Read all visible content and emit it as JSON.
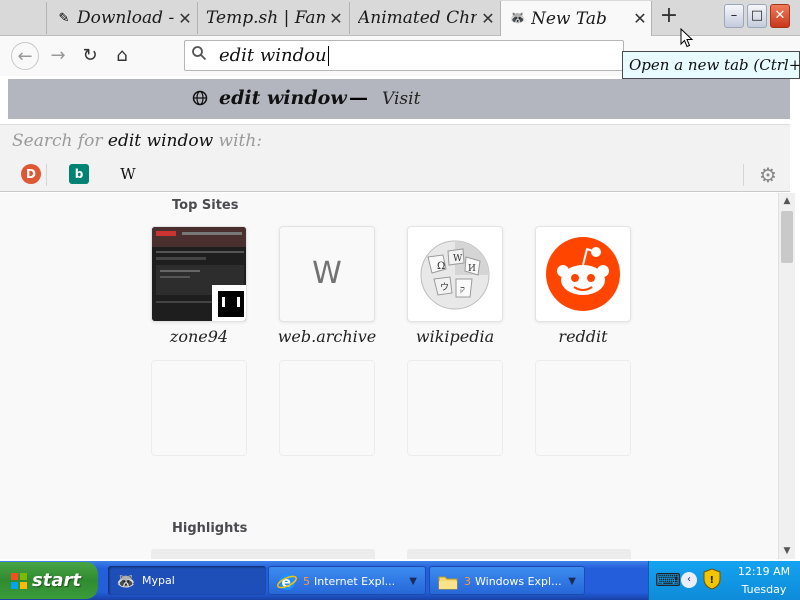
{
  "tabs": [
    {
      "title": "Download -",
      "icon": "tab-favicon-download-icon",
      "active": false
    },
    {
      "title": "Temp.sh | Fam",
      "icon": "",
      "active": false
    },
    {
      "title": "Animated Christ",
      "icon": "",
      "active": false
    },
    {
      "title": "New Tab",
      "icon": "mypal-icon",
      "active": true
    }
  ],
  "tab_close_glyph": "✕",
  "new_tab_glyph": "+",
  "window": {
    "minimize": "–",
    "maximize": "□",
    "close": "✕"
  },
  "nav": {
    "back": "←",
    "forward": "→",
    "reload": "↻",
    "home": "⌂"
  },
  "urlbar": {
    "value": "edit windou",
    "icon": "search-icon"
  },
  "tooltip": {
    "text": "Open a new tab (Ctrl+T)"
  },
  "suggestion": {
    "query": "edit window",
    "dash": "—",
    "action": "Visit"
  },
  "search_with": {
    "prefix": "Search for",
    "query": "edit window",
    "suffix": "with:"
  },
  "engines": [
    {
      "name": "duckduckgo-icon",
      "glyph": "D"
    },
    {
      "name": "bing-icon",
      "glyph": "b"
    },
    {
      "name": "wikipedia-icon",
      "glyph": "W"
    }
  ],
  "newtab": {
    "top_sites_title": "Top Sites",
    "highlights_title": "Highlights",
    "sites": [
      {
        "label": "zone94",
        "icon": "zone94-thumbnail"
      },
      {
        "label": "web.archive",
        "icon": "letter-w-icon",
        "letter": "W"
      },
      {
        "label": "wikipedia",
        "icon": "wikipedia-globe-icon"
      },
      {
        "label": "reddit",
        "icon": "reddit-icon"
      }
    ]
  },
  "taskbar": {
    "start": "start",
    "tasks": [
      {
        "label": "Mypal",
        "count": "",
        "active": true
      },
      {
        "label": "Internet Expl...",
        "count": "5",
        "active": false
      },
      {
        "label": "Windows Expl...",
        "count": "3",
        "active": false
      }
    ],
    "time": "12:19 AM",
    "day": "Tuesday"
  },
  "colors": {
    "accent": "#245edb",
    "start_green": "#3b9c3b",
    "reddit": "#ff4500",
    "tooltip_bg": "#e8fbff"
  }
}
